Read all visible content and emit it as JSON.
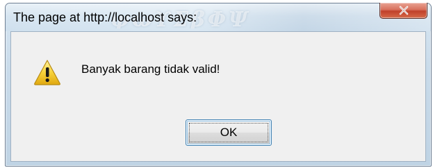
{
  "dialog": {
    "title": "The page at http://localhost says:",
    "message": "Banyak barang tidak valid!",
    "ok_label": "OK",
    "icon": "warning-icon",
    "close_icon": "close-icon"
  },
  "colors": {
    "close_button": "#c8503a",
    "warning_fill": "#f5c518",
    "focus_border": "#3c7fb1"
  }
}
